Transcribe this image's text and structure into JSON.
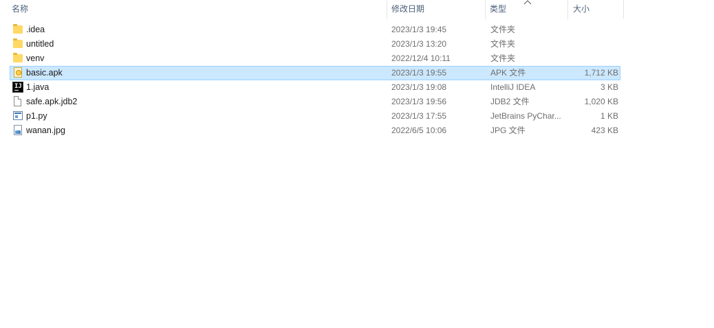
{
  "columns": {
    "name": "名称",
    "date": "修改日期",
    "type": "类型",
    "size": "大小"
  },
  "sort": {
    "column": "type",
    "direction": "ascending"
  },
  "colors": {
    "selected_bg": "#cce8ff",
    "selected_border": "#99d1ff",
    "header_text": "#4c607a",
    "secondary_text": "#6d6d6d"
  },
  "files": [
    {
      "name": ".idea",
      "date": "2023/1/3 19:45",
      "type": "文件夹",
      "size": "",
      "icon": "folder-icon",
      "selected": false
    },
    {
      "name": "untitled",
      "date": "2023/1/3 13:20",
      "type": "文件夹",
      "size": "",
      "icon": "folder-icon",
      "selected": false
    },
    {
      "name": "venv",
      "date": "2022/12/4 10:11",
      "type": "文件夹",
      "size": "",
      "icon": "folder-icon",
      "selected": false
    },
    {
      "name": "basic.apk",
      "date": "2023/1/3 19:55",
      "type": "APK 文件",
      "size": "1,712 KB",
      "icon": "apk-file-icon",
      "selected": true
    },
    {
      "name": "1.java",
      "date": "2023/1/3 19:08",
      "type": "IntelliJ IDEA",
      "size": "3 KB",
      "icon": "intellij-icon",
      "selected": false
    },
    {
      "name": "safe.apk.jdb2",
      "date": "2023/1/3 19:56",
      "type": "JDB2 文件",
      "size": "1,020 KB",
      "icon": "generic-file-icon",
      "selected": false
    },
    {
      "name": "p1.py",
      "date": "2023/1/3 17:55",
      "type": "JetBrains PyChar...",
      "size": "1 KB",
      "icon": "python-file-icon",
      "selected": false
    },
    {
      "name": "wanan.jpg",
      "date": "2022/6/5 10:06",
      "type": "JPG 文件",
      "size": "423 KB",
      "icon": "image-file-icon",
      "selected": false
    }
  ]
}
